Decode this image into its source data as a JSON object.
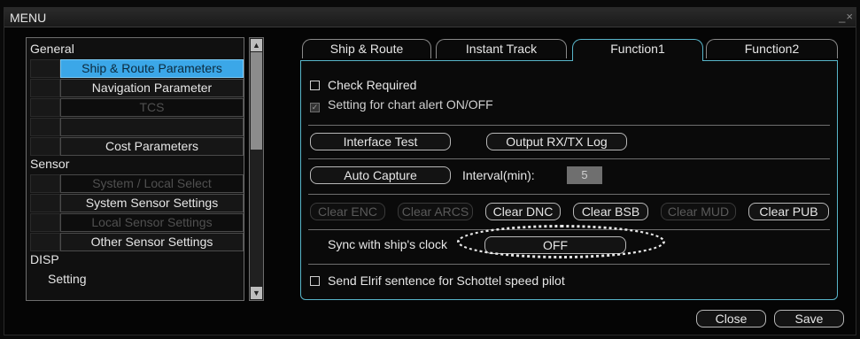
{
  "window": {
    "title": "MENU",
    "controls": "_×"
  },
  "tree": {
    "groups": [
      {
        "label": "General"
      },
      {
        "label": "Sensor"
      },
      {
        "label": "DISP"
      }
    ],
    "items": [
      {
        "label": "Ship & Route Parameters"
      },
      {
        "label": "Navigation Parameter"
      },
      {
        "label": "TCS"
      },
      {
        "label": ""
      },
      {
        "label": "Cost Parameters"
      },
      {
        "label": "System / Local Select"
      },
      {
        "label": "System Sensor Settings"
      },
      {
        "label": "Local Sensor Settings"
      },
      {
        "label": "Other Sensor Settings"
      },
      {
        "label": "Setting"
      }
    ]
  },
  "tabs": [
    {
      "label": "Ship & Route"
    },
    {
      "label": "Instant Track"
    },
    {
      "label": "Function1"
    },
    {
      "label": "Function2"
    }
  ],
  "panel": {
    "check_required": {
      "label": "Check Required",
      "checked": false
    },
    "chart_alert": {
      "label": "Setting for chart alert ON/OFF",
      "checked": true
    },
    "interface_test": "Interface Test",
    "output_log": "Output RX/TX Log",
    "auto_capture": "Auto Capture",
    "interval_label": "Interval(min):",
    "interval_value": "5",
    "clear_buttons": [
      {
        "label": "Clear ENC"
      },
      {
        "label": "Clear ARCS"
      },
      {
        "label": "Clear DNC"
      },
      {
        "label": "Clear BSB"
      },
      {
        "label": "Clear MUD"
      },
      {
        "label": "Clear PUB"
      }
    ],
    "sync_label": "Sync with ship's clock",
    "sync_value": "OFF",
    "elrif": {
      "label": "Send Elrif sentence for Schottel speed pilot",
      "checked": false
    }
  },
  "footer": {
    "close": "Close",
    "save": "Save"
  }
}
